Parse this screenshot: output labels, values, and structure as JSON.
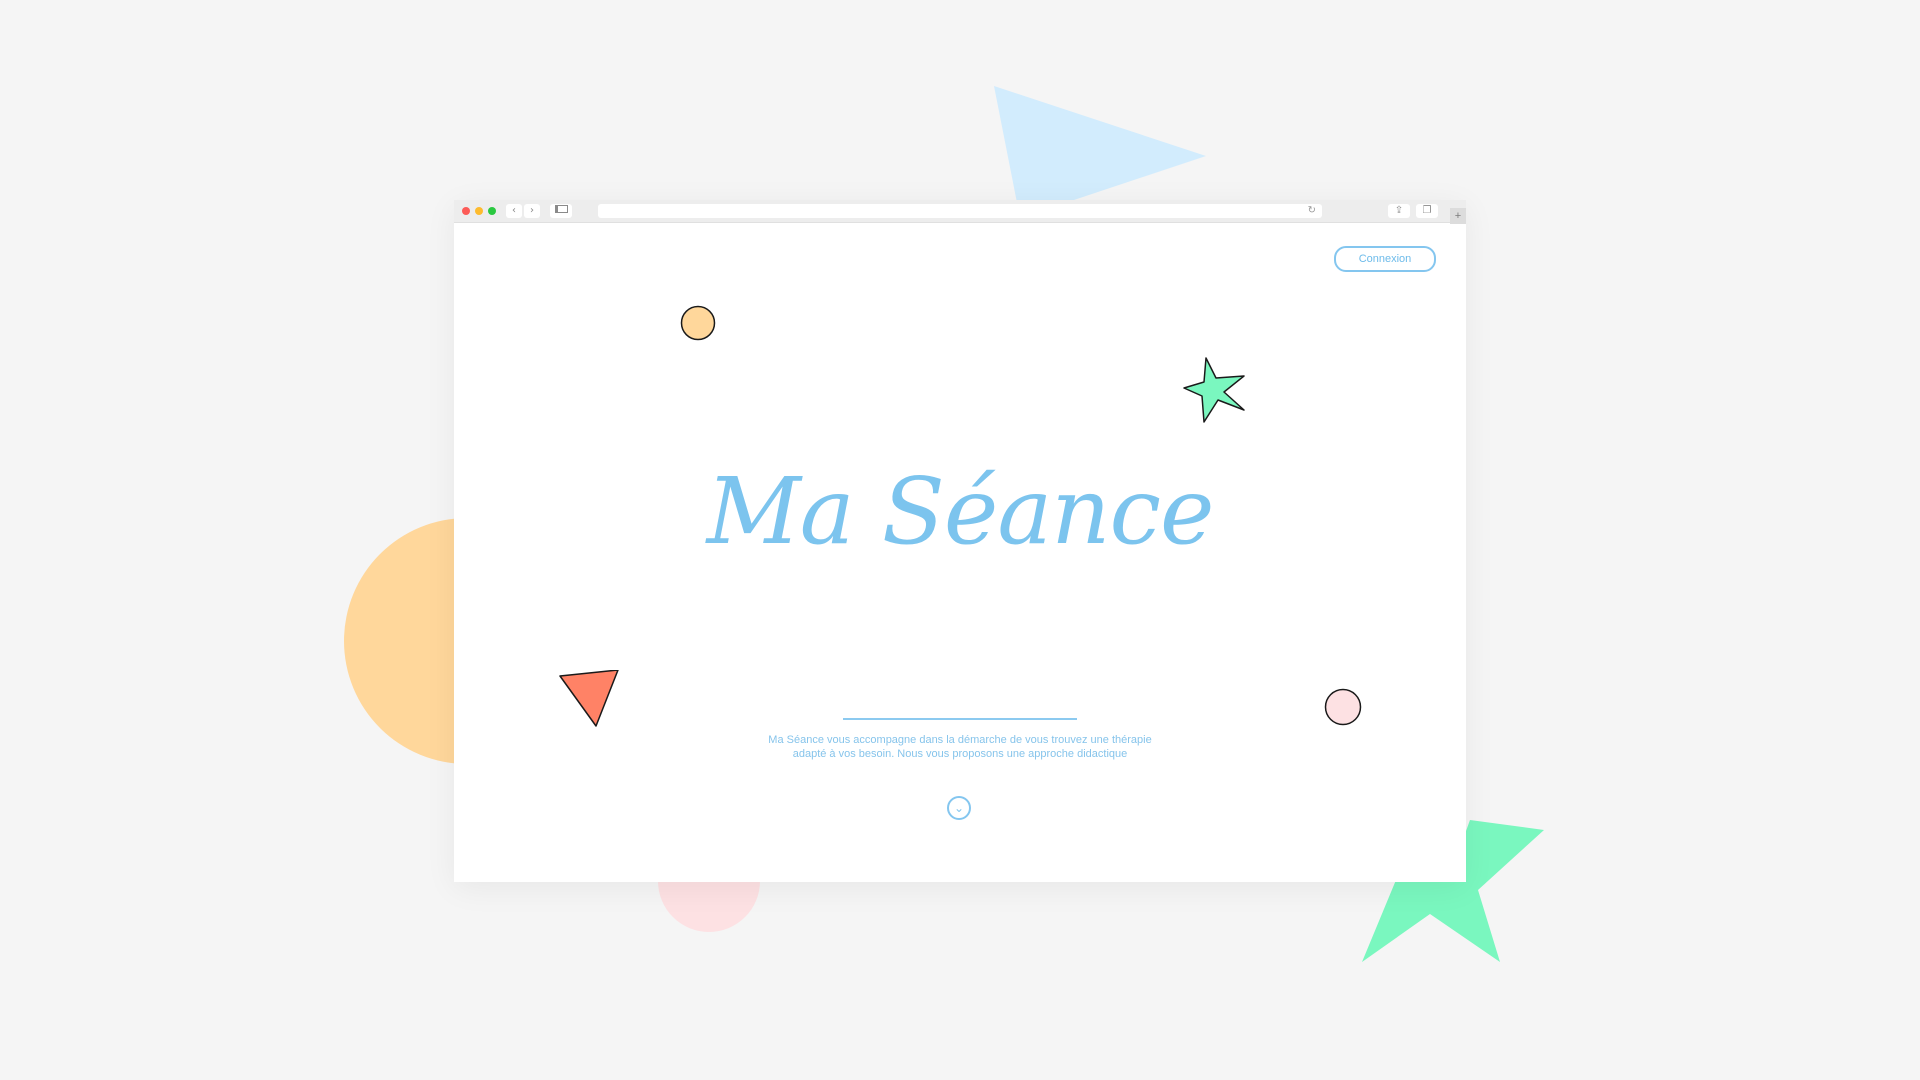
{
  "colors": {
    "background": "#f5f5f5",
    "accent_blue": "#7cc4ee",
    "shape_orange": "#ffd79b",
    "shape_pink": "#fde1e3",
    "shape_blue": "#d2ecfd",
    "shape_green": "#7af7bf",
    "shape_red": "#ff8266"
  },
  "browser": {
    "toolbar": {
      "back_icon": "‹",
      "forward_icon": "›",
      "reload_icon": "↻",
      "share_icon": "⇪",
      "tabs_icon": "❐",
      "new_tab_icon": "+"
    }
  },
  "page": {
    "login_label": "Connexion",
    "title": "Ma Séance",
    "description": "Ma Séance vous accompagne dans la démarche de vous trouvez une thérapie adapté à vos besoin. Nous vous proposons une approche didactique",
    "scroll_icon": "⌄"
  }
}
